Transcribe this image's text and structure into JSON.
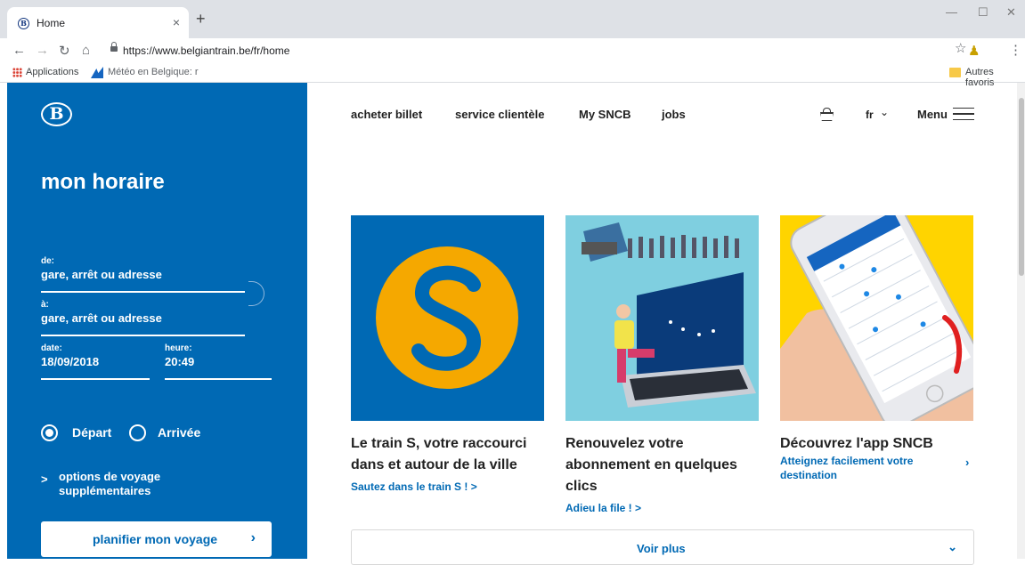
{
  "browser": {
    "tab_title": "Home",
    "tab_favicon": "B",
    "tab_close": "×",
    "new_tab": "+",
    "url": "https://www.belgiantrain.be/fr/home",
    "window_controls": {
      "minimize": "—",
      "maximize": "☐",
      "close": "✕"
    },
    "bookmarks": [
      "Applications",
      "Météo en Belgique: r"
    ],
    "other_bookmarks": "Autres favoris"
  },
  "panel": {
    "logo": "B",
    "title": "mon horaire",
    "from_label": "de:",
    "from_value": "gare, arrêt ou adresse",
    "to_label": "à:",
    "to_value": "gare, arrêt ou adresse",
    "date_label": "date:",
    "date_value": "18/09/2018",
    "time_label": "heure:",
    "time_value": "20:49",
    "departure_label": "Départ",
    "arrival_label": "Arrivée",
    "selected_mode": "Départ",
    "options_label": "options de voyage supplémentaires",
    "plan_button": "planifier mon voyage"
  },
  "nav": {
    "items": [
      "acheter billet",
      "service clientèle",
      "My SNCB",
      "jobs"
    ],
    "language": "fr",
    "menu_label": "Menu"
  },
  "cards": [
    {
      "title": "Le train S, votre raccourci dans et autour de la ville",
      "link": "Sautez dans le train S ! >",
      "image_bg": "#0069b4"
    },
    {
      "title": "Renouvelez votre abonnement en quelques clics",
      "link": "Adieu la file ! >",
      "image_bg": "#7fcfe0"
    },
    {
      "title": "Découvrez l'app SNCB",
      "link": "Atteignez facilement votre destination",
      "image_bg": "#ffd400"
    }
  ],
  "more_button": "Voir plus",
  "colors": {
    "sncb_blue": "#0069b4",
    "s_orange": "#f5a800"
  },
  "icons": [
    "back-icon",
    "forward-icon",
    "reload-icon",
    "home-icon",
    "lock-icon",
    "star-icon",
    "basket-icon",
    "hamburger-icon",
    "swap-icon"
  ]
}
